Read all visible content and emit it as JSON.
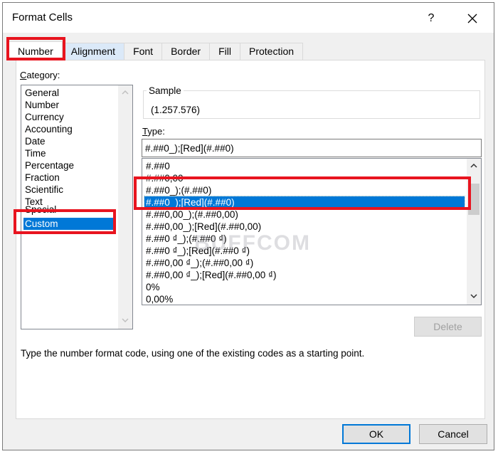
{
  "window": {
    "title": "Format Cells",
    "help_label": "?",
    "close_icon": "close-icon"
  },
  "tabs": [
    {
      "label": "Number",
      "active": true
    },
    {
      "label": "Alignment",
      "active": false
    },
    {
      "label": "Font",
      "active": false
    },
    {
      "label": "Border",
      "active": false
    },
    {
      "label": "Fill",
      "active": false
    },
    {
      "label": "Protection",
      "active": false
    }
  ],
  "category": {
    "label_accel": "C",
    "label_rest": "ategory:",
    "items": [
      "General",
      "Number",
      "Currency",
      "Accounting",
      "Date",
      "Time",
      "Percentage",
      "Fraction",
      "Scientific",
      "Text",
      "Special",
      "Custom"
    ],
    "selected": "Custom"
  },
  "sample": {
    "legend": "Sample",
    "value": "(1.257.576)"
  },
  "type": {
    "label_accel": "T",
    "label_rest": "ype:",
    "value": "#.##0_);[Red](#.##0)",
    "items": [
      "#.##0",
      "#.##0,00",
      "#.##0_);(#.##0)",
      "#.##0_);[Red](#.##0)",
      "#.##0,00_);(#.##0,00)",
      "#.##0,00_);[Red](#.##0,00)",
      "#.##0 ₫_);(#.##0 ₫)",
      "#.##0 ₫_);[Red](#.##0 ₫)",
      "#.##0,00 ₫_);(#.##0,00 ₫)",
      "#.##0,00 ₫_);[Red](#.##0,00 ₫)",
      "0%",
      "0,00%"
    ],
    "selected": "#.##0_);[Red](#.##0)"
  },
  "delete_label": "Delete",
  "hint": "Type the number format code, using one of the existing codes as a starting point.",
  "ok_label": "OK",
  "cancel_label": "Cancel",
  "watermark": "BUFFCOM",
  "colors": {
    "accent": "#0078d7",
    "highlight_annotation": "#e8141f",
    "dialog_bg": "#f0f0f0"
  }
}
